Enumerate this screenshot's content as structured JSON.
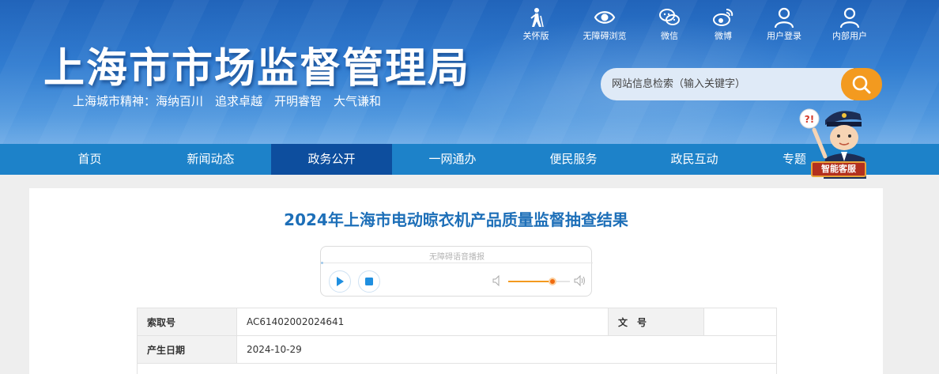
{
  "header": {
    "title": "上海市市场监督管理局",
    "motto": "上海城市精神：海纳百川　追求卓越　开明睿智　大气谦和"
  },
  "toolbar": [
    {
      "label": "关怀版",
      "icon": "elderly-care-icon"
    },
    {
      "label": "无障碍浏览",
      "icon": "eye-icon"
    },
    {
      "label": "微信",
      "icon": "wechat-icon"
    },
    {
      "label": "微博",
      "icon": "weibo-icon"
    },
    {
      "label": "用户登录",
      "icon": "user-icon"
    },
    {
      "label": "内部用户",
      "icon": "user-icon"
    }
  ],
  "search": {
    "placeholder": "网站信息检索（输入关键字）",
    "value": ""
  },
  "nav": [
    {
      "label": "首页"
    },
    {
      "label": "新闻动态"
    },
    {
      "label": "政务公开",
      "active": true
    },
    {
      "label": "一网通办"
    },
    {
      "label": "便民服务"
    },
    {
      "label": "政民互动"
    },
    {
      "label": "专题"
    }
  ],
  "assistant": {
    "label": "智能客服",
    "bubble": "?!"
  },
  "article": {
    "title": "2024年上海市电动晾衣机产品质量监督抽查结果"
  },
  "player": {
    "label": "无障碍语音播报",
    "volume": 0.72
  },
  "info_table": {
    "rows": [
      {
        "key": "索取号",
        "value": "AC61402002024641",
        "key2": "文　号",
        "value2": ""
      },
      {
        "key": "产生日期",
        "value": "2024-10-29"
      }
    ]
  },
  "colors": {
    "nav_bg": "#1d82c9",
    "nav_active": "#0d4e9e",
    "accent_orange": "#f39a1f",
    "title_blue": "#1d6fb8"
  }
}
